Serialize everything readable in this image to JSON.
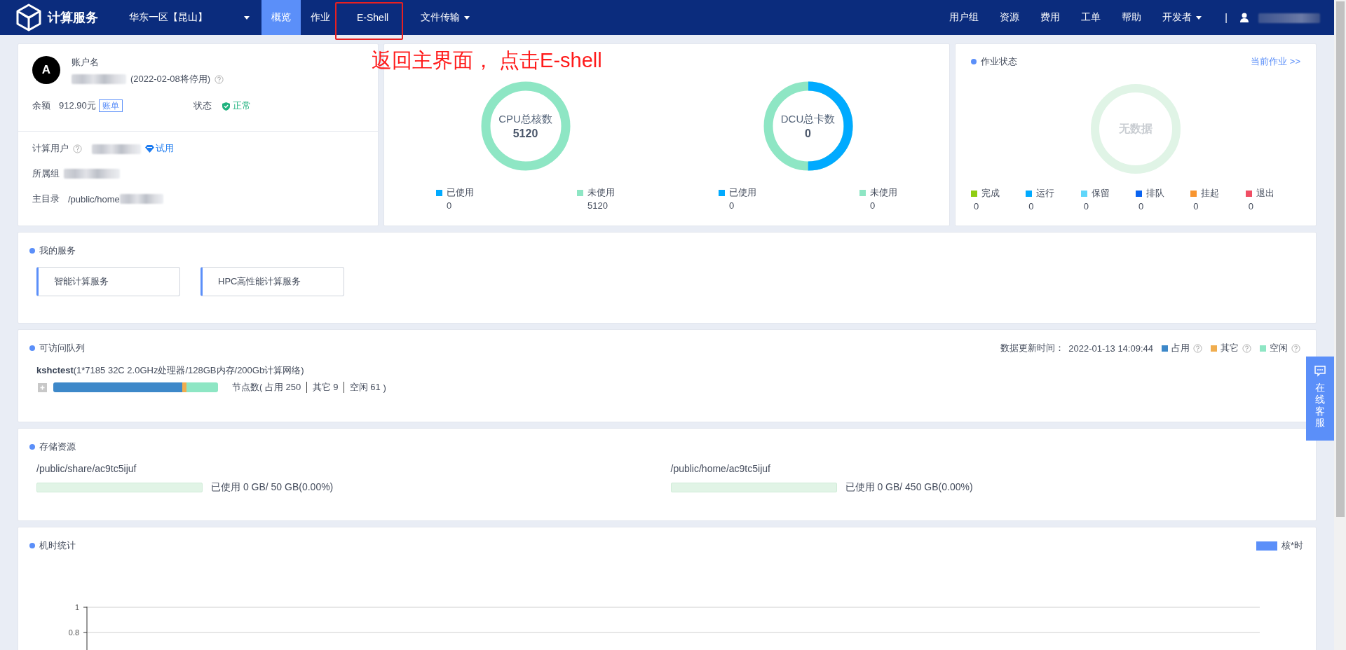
{
  "brand": {
    "name": "计算服务"
  },
  "region": {
    "label": "华东一区【昆山】"
  },
  "nav_tabs": [
    {
      "label": "概览",
      "selected": true,
      "dropdown": false
    },
    {
      "label": "作业",
      "selected": false,
      "dropdown": false
    },
    {
      "label": "E-Shell",
      "selected": false,
      "dropdown": false
    },
    {
      "label": "文件传输",
      "selected": false,
      "dropdown": true
    }
  ],
  "user_menu": [
    {
      "label": "用户组",
      "dropdown": false
    },
    {
      "label": "资源",
      "dropdown": false
    },
    {
      "label": "费用",
      "dropdown": false
    },
    {
      "label": "工单",
      "dropdown": false
    },
    {
      "label": "帮助",
      "dropdown": false
    },
    {
      "label": "开发者",
      "dropdown": true
    }
  ],
  "menu_separator": "|",
  "annotation": {
    "text": "返回主界面， 点击E-shell"
  },
  "account": {
    "avatar": "A",
    "title": "账户名",
    "expiry": "(2022-02-08将停用)",
    "balance_label": "余额",
    "balance": "912.90元",
    "bill_link": "账单",
    "status_label": "状态",
    "status": "正常",
    "compute_user_label": "计算用户",
    "trial": "试用",
    "group_label": "所属组",
    "home_label": "主目录",
    "home_path": "/public/home"
  },
  "resources": [
    {
      "title": "CPU总核数",
      "total": "5120",
      "legend": [
        {
          "label": "已使用",
          "value": "0",
          "color": "#00aaff"
        },
        {
          "label": "未使用",
          "value": "5120",
          "color": "#8ee6c4"
        }
      ]
    },
    {
      "title": "DCU总卡数",
      "total": "0",
      "legend": [
        {
          "label": "已使用",
          "value": "0",
          "color": "#00aaff"
        },
        {
          "label": "未使用",
          "value": "0",
          "color": "#8ee6c4"
        }
      ]
    }
  ],
  "job_status": {
    "title": "作业状态",
    "link": "当前作业 >>",
    "empty_text": "无数据",
    "legend": [
      {
        "label": "完成",
        "value": "0",
        "color": "#8fcd12"
      },
      {
        "label": "运行",
        "value": "0",
        "color": "#00aaff"
      },
      {
        "label": "保留",
        "value": "0",
        "color": "#5fd6fa"
      },
      {
        "label": "排队",
        "value": "0",
        "color": "#0a63f0"
      },
      {
        "label": "挂起",
        "value": "0",
        "color": "#f89530"
      },
      {
        "label": "退出",
        "value": "0",
        "color": "#f04e64"
      }
    ]
  },
  "services": {
    "title": "我的服务",
    "items": [
      {
        "label": "智能计算服务"
      },
      {
        "label": "HPC高性能计算服务"
      }
    ]
  },
  "queues": {
    "title": "可访问队列",
    "update_label": "数据更新时间：",
    "update_time": "2022-01-13 14:09:44",
    "legend": [
      {
        "label": "占用",
        "color": "#3d88c9"
      },
      {
        "label": "其它",
        "color": "#f0ad4e"
      },
      {
        "label": "空闲",
        "color": "#8ee6c4"
      }
    ],
    "items": [
      {
        "name": "kshctest",
        "spec": "(1*7185 32C 2.0GHz处理器/128GB内存/200Gb计算网络)",
        "node_label": "节点数(",
        "node_counts": [
          {
            "label": "占用",
            "value": "250"
          },
          {
            "label": "其它",
            "value": "9"
          },
          {
            "label": "空闲",
            "value": "61"
          }
        ],
        "node_end": ")"
      }
    ]
  },
  "storage": {
    "title": "存储资源",
    "items": [
      {
        "path": "/public/share/ac9tc5ijuf",
        "level": 0,
        "usage": "已使用 0 GB/ 50 GB(0.00%)"
      },
      {
        "path": "/public/home/ac9tc5ijuf",
        "level": 0,
        "usage": "已使用 0 GB/ 450 GB(0.00%)"
      }
    ]
  },
  "usage_stats": {
    "title": "机时统计",
    "chart_data": {
      "type": "bar",
      "ylim": [
        0,
        1
      ],
      "yticks": [
        0.8,
        1
      ],
      "series": [
        {
          "name": "核*时",
          "color": "#5b8ff9"
        }
      ]
    }
  },
  "support": {
    "label": "在线客服"
  }
}
